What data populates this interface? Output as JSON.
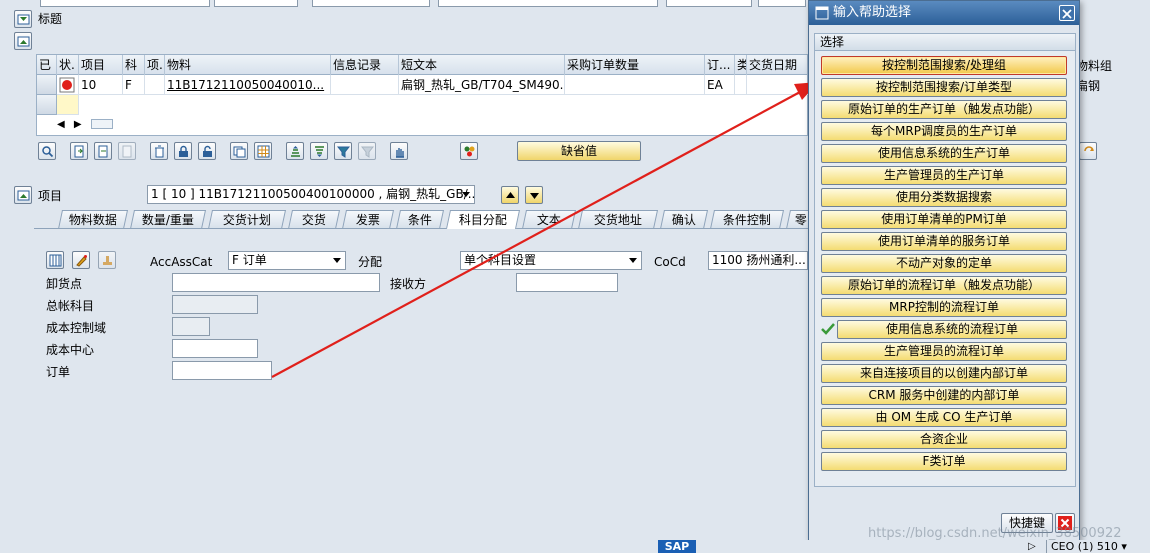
{
  "top_fields": [
    "",
    "",
    "",
    "",
    "",
    ""
  ],
  "title_label": "标题",
  "grid": {
    "headers": [
      "已",
      "状.",
      "项目",
      "科",
      "项.",
      "物料",
      "信息记录",
      "短文本",
      "采购订单数量",
      "订...",
      "类",
      "交货日期",
      "物料组"
    ],
    "row": {
      "item": "10",
      "account_cat": "F",
      "material": "11B1712110050040010...",
      "short_text": "扁钢_热轧_GB/T704_SM490...",
      "unit": "EA",
      "material_group": "扁钢"
    }
  },
  "default_button": "缺省值",
  "item_label": "项目",
  "item_select": "1 [ 10 ] 11B17121100500400100000 , 扁钢_热轧_GB/...",
  "tabs": [
    "物料数据",
    "数量/重量",
    "交货计划",
    "交货",
    "发票",
    "条件",
    "科目分配",
    "文本",
    "交货地址",
    "确认",
    "条件控制",
    "零"
  ],
  "active_tab": "科目分配",
  "form": {
    "accasscat_label": "AccAssCat",
    "accasscat_value": "F 订单",
    "distribution_label": "分配",
    "distribution_value": "单个科目设置",
    "cocd_label": "CoCd",
    "cocd_value": "1100 扬州通利...",
    "unloading_label": "卸货点",
    "recipient_label": "接收方",
    "gl_label": "总帐科目",
    "ca_label": "成本控制域",
    "cc_label": "成本中心",
    "order_label": "订单"
  },
  "dialog": {
    "title": "输入帮助选择",
    "group_title": "选择",
    "options": [
      "按控制范围搜索/处理组",
      "按控制范围搜索/订单类型",
      "原始订单的生产订单（触发点功能）",
      "每个MRP调度员的生产订单",
      "使用信息系统的生产订单",
      "生产管理员的生产订单",
      "使用分类数据搜索",
      "使用订单清单的PM订单",
      "使用订单清单的服务订单",
      "不动产对象的定单",
      "原始订单的流程订单（触发点功能）",
      "MRP控制的流程订单",
      "使用信息系统的流程订单",
      "生产管理员的流程订单",
      "来自连接项目的以创建内部订单",
      "CRM 服务中创建的内部订单",
      "由 OM 生成 CO 生产订单",
      "合资企业",
      "F类订单"
    ],
    "selected_index": 0,
    "checked_index": 12,
    "shortcut_label": "快捷键"
  },
  "status": {
    "sap": "SAP",
    "system": "CEO (1) 510"
  },
  "watermark": "https://blog.csdn.net/weixin_38500922",
  "colors": {
    "button_fill": "#f4dc72",
    "dialog_title": "#2c5f98",
    "arrow": "#e0201b"
  }
}
